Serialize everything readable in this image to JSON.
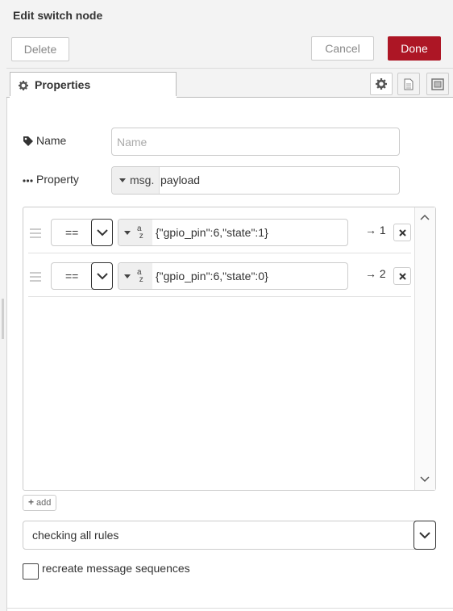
{
  "header": {
    "title": "Edit switch node"
  },
  "toolbar": {
    "delete_label": "Delete",
    "cancel_label": "Cancel",
    "done_label": "Done",
    "done_color": "#ad1625"
  },
  "tabs": {
    "properties_label": "Properties",
    "icons": [
      "gear-icon",
      "description-icon",
      "appearance-icon"
    ]
  },
  "form": {
    "name_label": "Name",
    "name_placeholder": "Name",
    "name_value": "",
    "property_label": "Property",
    "property_type_prefix": "msg.",
    "property_value": "payload"
  },
  "rules": [
    {
      "operator": "==",
      "value": "{\"gpio_pin\":6,\"state\":1}",
      "output": "→ 1"
    },
    {
      "operator": "==",
      "value": "{\"gpio_pin\":6,\"state\":0}",
      "output": "→ 2"
    }
  ],
  "add_label": "add",
  "check_mode": {
    "value": "checking all rules"
  },
  "recreate_sequences": {
    "label": "recreate message sequences",
    "checked": false
  }
}
